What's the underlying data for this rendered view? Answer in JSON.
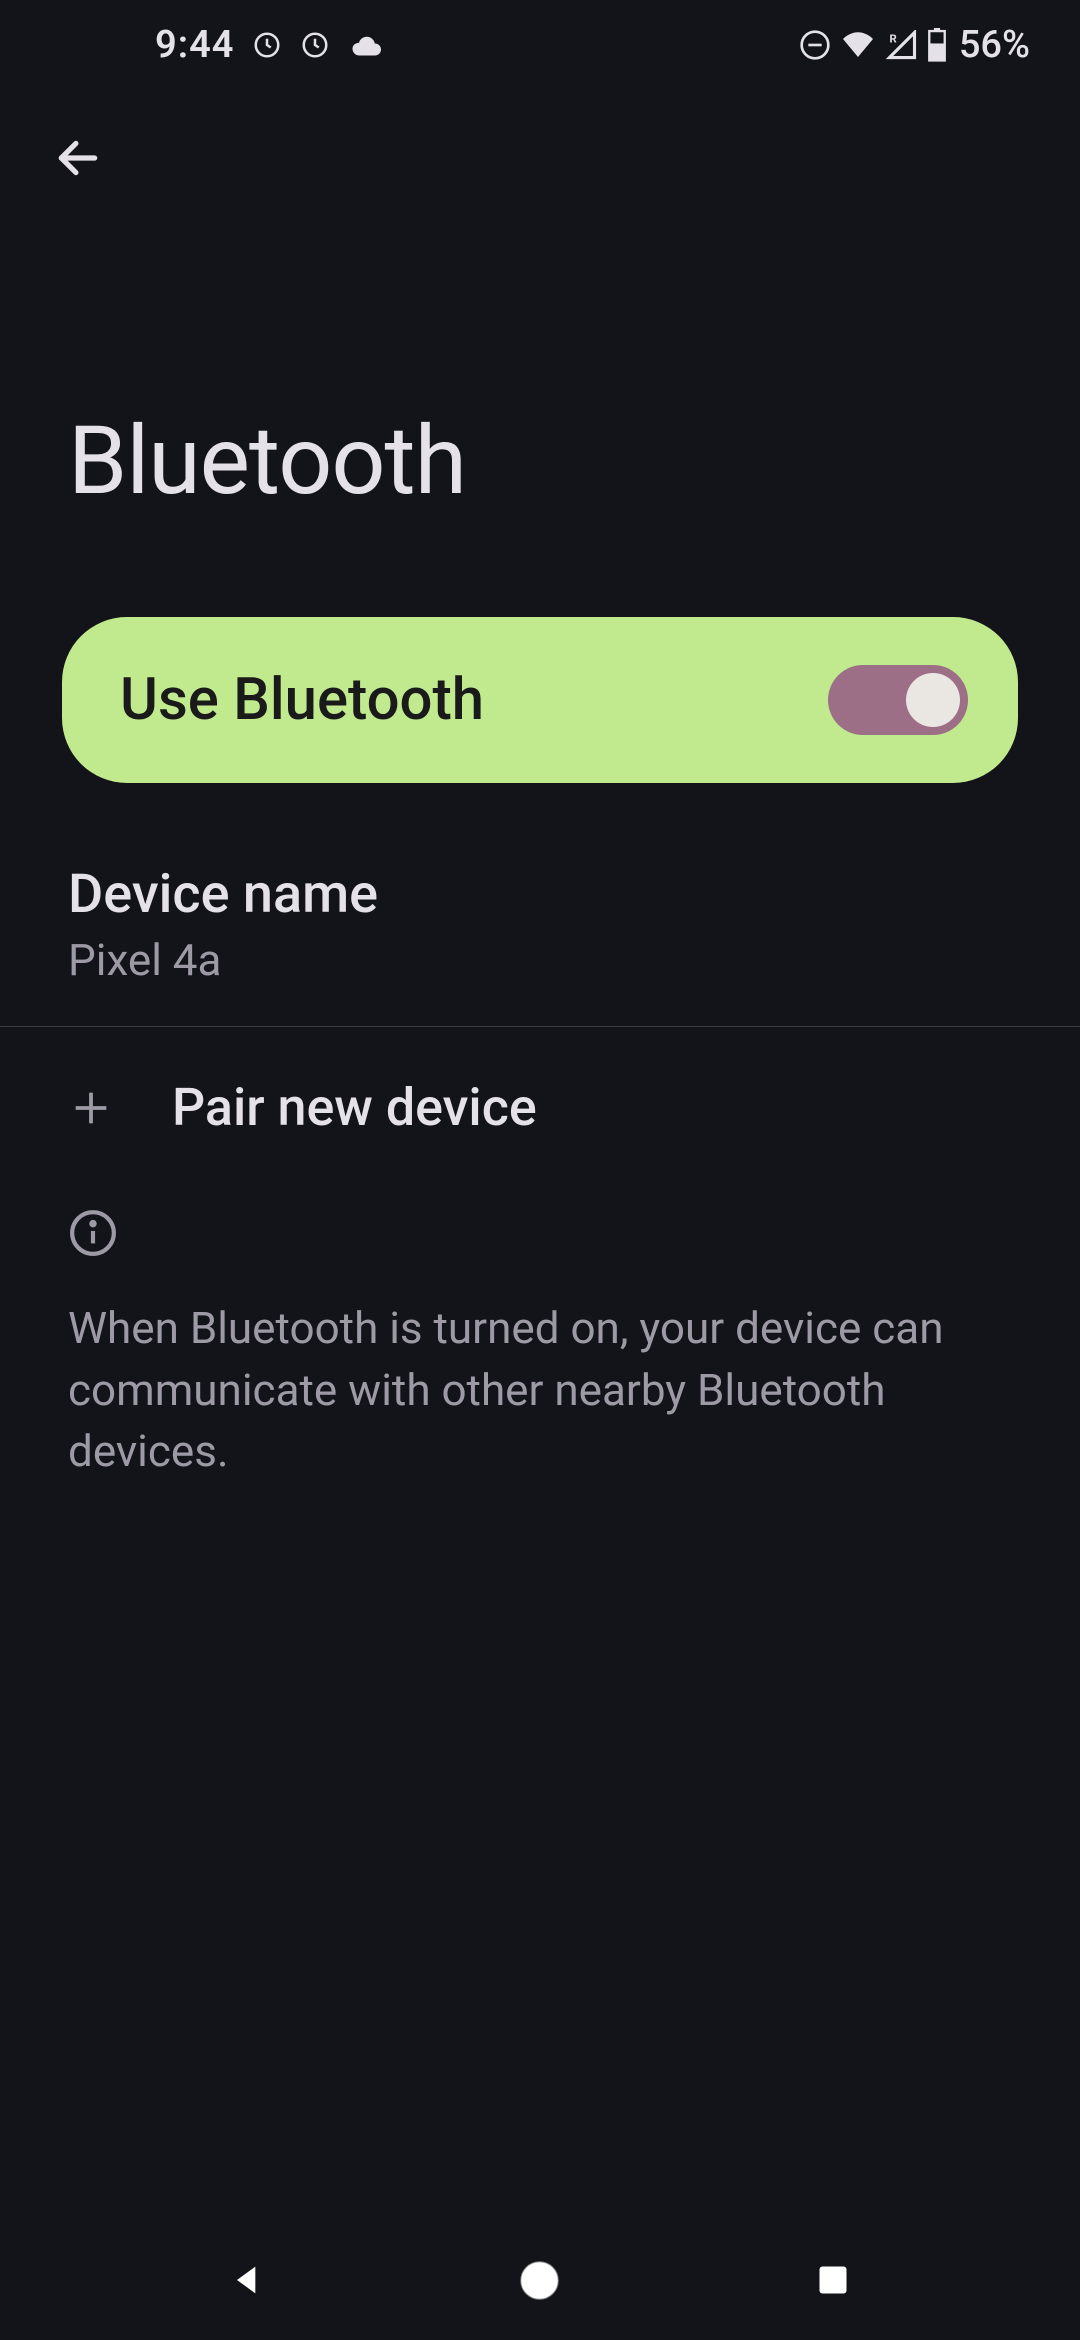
{
  "status_bar": {
    "time": "9:44",
    "battery_percent": "56%"
  },
  "page": {
    "title": "Bluetooth"
  },
  "toggle": {
    "label": "Use Bluetooth",
    "enabled": true
  },
  "device_name": {
    "title": "Device name",
    "value": "Pixel 4a"
  },
  "pair": {
    "label": "Pair new device"
  },
  "info": {
    "text": "When Bluetooth is turned on, your device can communicate with other nearby Bluetooth devices."
  }
}
